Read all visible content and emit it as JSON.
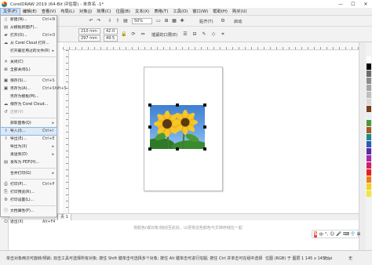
{
  "window": {
    "title": "CorelDRAW 2019 (64-Bit 评估版) - 未命名 -1*",
    "minimize": "—",
    "maximize": "☐",
    "close": "✕"
  },
  "menubar": {
    "items": [
      "文件(F)",
      "编辑(E)",
      "查看(V)",
      "布局(L)",
      "对象(J)",
      "效果(C)",
      "位图(B)",
      "文本(X)",
      "表格(T)",
      "工具(O)",
      "窗口(W)",
      "帮助(H)",
      "购买(U)"
    ]
  },
  "toolbar": {
    "zoom_value": "50%",
    "snap_label": "贴齐(T)",
    "launch_label": "启动",
    "width_value": "210 mm",
    "height_value": "297 mm",
    "x_value": "42.0",
    "y_value": "49.5",
    "units_label": "单位",
    "import_label": "插紧的口限(E)"
  },
  "file_menu": {
    "items": [
      {
        "label": "新建(N)...",
        "shortcut": "Ctrl+N",
        "icon": "new-document-icon"
      },
      {
        "label": "从模板新建(F)...",
        "shortcut": "",
        "icon": "template-icon"
      },
      {
        "label": "打开(O)...",
        "shortcut": "Ctrl+O",
        "icon": "open-folder-icon"
      },
      {
        "label": "从 Corel Cloud 打开...",
        "shortcut": "",
        "icon": "cloud-icon"
      },
      {
        "label": "打开最近用过的文件(R)",
        "shortcut": "",
        "icon": "",
        "submenu": true
      },
      {
        "label": "关闭(C)",
        "shortcut": "",
        "icon": "close-document-icon"
      },
      {
        "label": "全部关闭(L)",
        "shortcut": "",
        "icon": "close-all-icon"
      },
      {
        "label": "保存(S)...",
        "shortcut": "Ctrl+S",
        "icon": "save-icon"
      },
      {
        "label": "另存为(A)...",
        "shortcut": "Ctrl+Shift+S",
        "icon": "save-as-icon"
      },
      {
        "label": "另存为模板(M)...",
        "shortcut": "",
        "icon": ""
      },
      {
        "label": "保存为 Corel Cloud...",
        "shortcut": "",
        "icon": "cloud-save-icon"
      },
      {
        "label": "还原(V)",
        "shortcut": "",
        "icon": "revert-icon",
        "disabled": true
      },
      {
        "label": "获取图像(Q)",
        "shortcut": "",
        "icon": "",
        "submenu": true
      },
      {
        "label": "导入(I)...",
        "shortcut": "Ctrl+I",
        "icon": "import-icon",
        "hover": true
      },
      {
        "label": "导出(E)...",
        "shortcut": "Ctrl+E",
        "icon": "export-icon"
      },
      {
        "label": "导出为(X)",
        "shortcut": "",
        "icon": "",
        "submenu": true
      },
      {
        "label": "发送到(D)",
        "shortcut": "",
        "icon": "",
        "submenu": true
      },
      {
        "label": "发布为 PDF(H)...",
        "shortcut": "",
        "icon": "pdf-icon"
      },
      {
        "label": "合并打印(G)",
        "shortcut": "",
        "icon": "",
        "submenu": true
      },
      {
        "label": "打印(P)...",
        "shortcut": "Ctrl+P",
        "icon": "print-icon"
      },
      {
        "label": "打印预览(R)...",
        "shortcut": "",
        "icon": "print-preview-icon"
      },
      {
        "label": "打印设置(L)...",
        "shortcut": "",
        "icon": "print-setup-icon"
      },
      {
        "label": "文档属性(P)...",
        "shortcut": "",
        "icon": "document-properties-icon"
      },
      {
        "label": "退出(X)",
        "shortcut": "Alt+F4",
        "icon": "exit-icon"
      }
    ]
  },
  "document": {
    "page_tab": "页 1",
    "drag_hint": "将颜色(或对象)拖动至此处，以便将这些颜色与文档存储在一起"
  },
  "ime": {
    "logo": "S",
    "mode": "中",
    "cells": [
      "°,",
      "☺",
      "🎤",
      "⌨",
      "👕",
      "⊞"
    ]
  },
  "statusbar": {
    "hint": "单击对象两次可旋转/倾斜; 双击工具可选择所有对象; 按住 Shift 键单击可选择多个对象; 按住 Alt 键单击可进行挖掘; 按住 Ctrl 并单击可在组中选择",
    "object_info": "位图 (RGB) 于 图层 1 145 x 145 dpi",
    "fill_none": "无",
    "outline_none": "无"
  },
  "palette_colors": [
    "#ffffff",
    "#000000",
    "#6b6b6b",
    "#8c8c8c",
    "#a6a6a6",
    "#bfbfbf",
    "#d9d9d9",
    "#7a3e1a",
    "#e8eef6",
    "#4a9a3a",
    "#a45a2a",
    "#1a8a8a",
    "#2a5ab8",
    "#5a2aa8",
    "#a82aa8",
    "#d81a6a",
    "#e8201a",
    "#f07a1a",
    "#f4d21a",
    "#f0e83a"
  ]
}
